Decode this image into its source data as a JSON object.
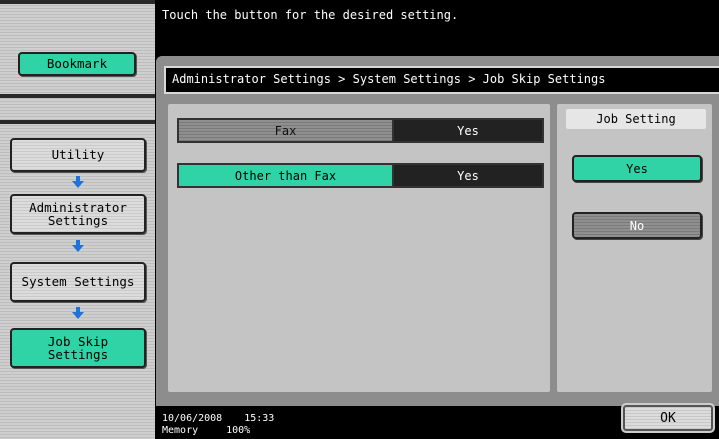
{
  "header": {
    "message": "Touch the button for the desired setting."
  },
  "sidebar": {
    "bookmark_label": "Bookmark",
    "steps": [
      {
        "label": "Utility"
      },
      {
        "label": "Administrator\nSettings"
      },
      {
        "label": "System Settings"
      },
      {
        "label": "Job Skip\nSettings"
      }
    ],
    "arrow_icon": "arrow-down-icon"
  },
  "breadcrumb": "Administrator Settings > System Settings > Job Skip Settings",
  "settings": [
    {
      "label": "Fax",
      "value": "Yes",
      "selected": false
    },
    {
      "label": "Other than Fax",
      "value": "Yes",
      "selected": true
    }
  ],
  "job_setting": {
    "title": "Job Setting",
    "options": [
      {
        "label": "Yes",
        "selected": true
      },
      {
        "label": "No",
        "selected": false
      }
    ]
  },
  "footer": {
    "date": "10/06/2008",
    "time": "15:33",
    "memory_label": "Memory",
    "memory_value": "100%",
    "ok_label": "OK"
  },
  "colors": {
    "accent_green": "#2fd3a5",
    "arrow_blue": "#1e73d8"
  }
}
